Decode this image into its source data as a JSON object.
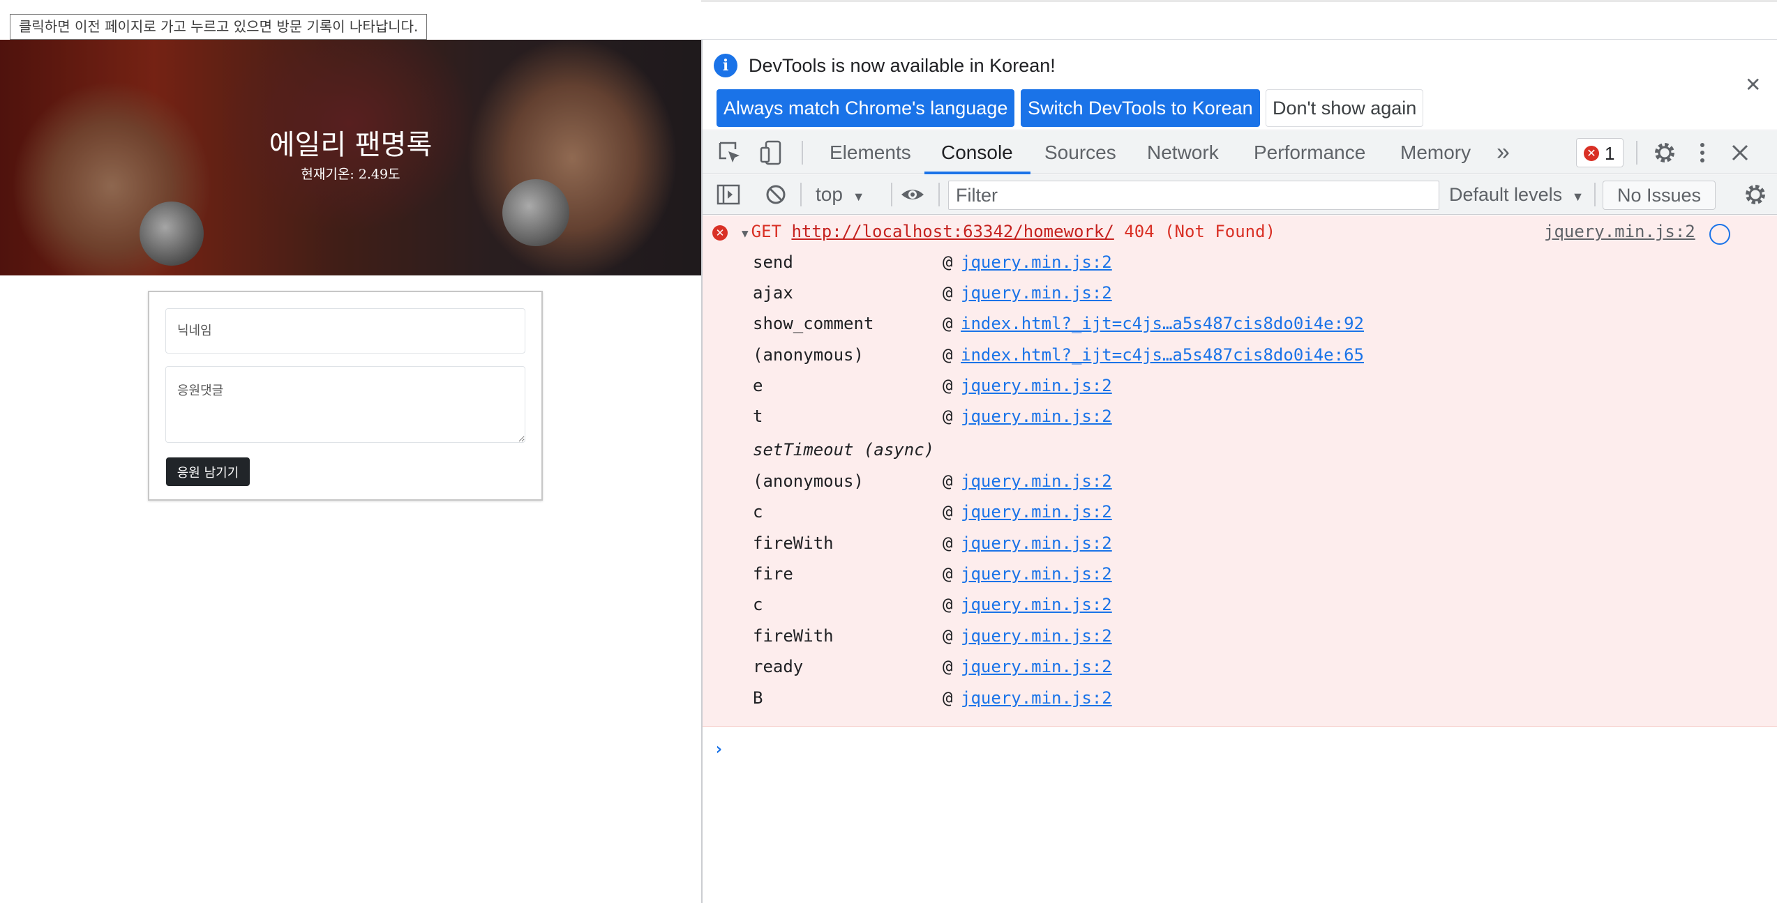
{
  "browser": {
    "tooltip": "클릭하면 이전 페이지로 가고 누르고 있으면 방문 기록이 나타납니다."
  },
  "page": {
    "title": "에일리 팬명록",
    "weather": "현재기온: 2.49도",
    "form": {
      "nickname_placeholder": "닉네임",
      "comment_placeholder": "응원댓글",
      "submit_label": "응원 남기기"
    }
  },
  "devtools": {
    "infobar": {
      "message": "DevTools is now available in Korean!",
      "btn_match": "Always match Chrome's language",
      "btn_switch": "Switch DevTools to Korean",
      "btn_dismiss": "Don't show again",
      "close": "✕"
    },
    "tabs": [
      "Elements",
      "Console",
      "Sources",
      "Network",
      "Performance",
      "Memory"
    ],
    "more_tabs": "»",
    "error_count": "1",
    "toolbar": {
      "context": "top",
      "filter_placeholder": "Filter",
      "levels": "Default levels",
      "issues": "No Issues"
    },
    "error": {
      "method": "GET",
      "url": "http://localhost:63342/homework/",
      "status": "404 (Not Found)",
      "source": "jquery.min.js:2"
    },
    "stack": [
      {
        "fn": "send",
        "loc": "jquery.min.js:2"
      },
      {
        "fn": "ajax",
        "loc": "jquery.min.js:2"
      },
      {
        "fn": "show_comment",
        "loc": "index.html?_ijt=c4js…a5s487cis8do0i4e:92"
      },
      {
        "fn": "(anonymous)",
        "loc": "index.html?_ijt=c4js…a5s487cis8do0i4e:65"
      },
      {
        "fn": "e",
        "loc": "jquery.min.js:2"
      },
      {
        "fn": "t",
        "loc": "jquery.min.js:2"
      }
    ],
    "async_label": "setTimeout (async)",
    "stack2": [
      {
        "fn": "(anonymous)",
        "loc": "jquery.min.js:2"
      },
      {
        "fn": "c",
        "loc": "jquery.min.js:2"
      },
      {
        "fn": "fireWith",
        "loc": "jquery.min.js:2"
      },
      {
        "fn": "fire",
        "loc": "jquery.min.js:2"
      },
      {
        "fn": "c",
        "loc": "jquery.min.js:2"
      },
      {
        "fn": "fireWith",
        "loc": "jquery.min.js:2"
      },
      {
        "fn": "ready",
        "loc": "jquery.min.js:2"
      },
      {
        "fn": "B",
        "loc": "jquery.min.js:2"
      }
    ],
    "at_sign": "@",
    "prompt": "›"
  }
}
